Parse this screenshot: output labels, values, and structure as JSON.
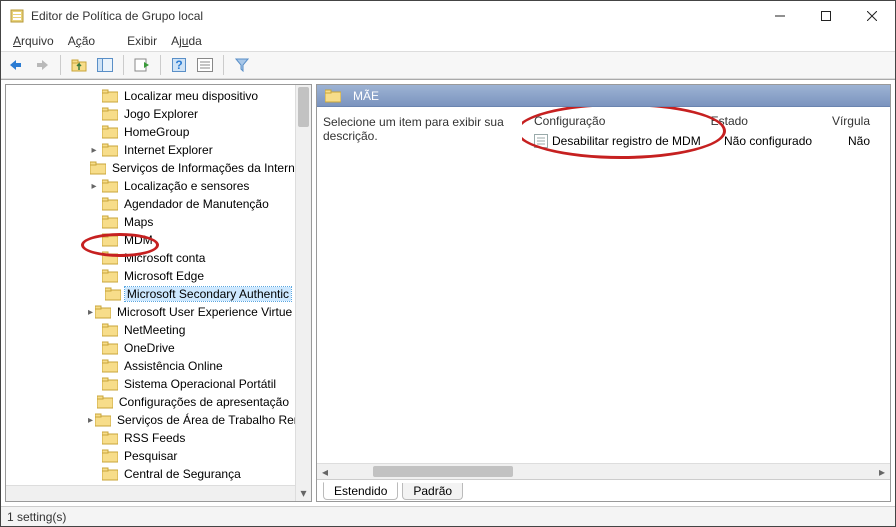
{
  "window": {
    "title": "Editor de Política de Grupo local"
  },
  "menubar": {
    "file": "Arquivo",
    "action": "Ação",
    "view": "Exibir",
    "help": "Ajuda"
  },
  "tree": {
    "items": [
      {
        "label": "Localizar meu dispositivo",
        "indent": 82,
        "exp": ""
      },
      {
        "label": "Jogo Explorer",
        "indent": 82,
        "exp": ""
      },
      {
        "label": "HomeGroup",
        "indent": 82,
        "exp": ""
      },
      {
        "label": "Internet Explorer",
        "indent": 82,
        "exp": ">"
      },
      {
        "label": "Serviços de Informações da Internet",
        "indent": 82,
        "exp": ""
      },
      {
        "label": "Localização e sensores",
        "indent": 82,
        "exp": ">"
      },
      {
        "label": "Agendador de Manutenção",
        "indent": 82,
        "exp": ""
      },
      {
        "label": "Maps",
        "indent": 82,
        "exp": ""
      },
      {
        "label": "MDM",
        "indent": 82,
        "exp": "",
        "highlighted": true
      },
      {
        "label": "Microsoft conta",
        "indent": 82,
        "exp": ""
      },
      {
        "label": "Microsoft Edge",
        "indent": 82,
        "exp": ""
      },
      {
        "label": "Microsoft Secondary Authentic",
        "indent": 96,
        "exp": "",
        "selected": true
      },
      {
        "label": "Microsoft User Experience Virtue",
        "indent": 82,
        "exp": ">"
      },
      {
        "label": "NetMeeting",
        "indent": 82,
        "exp": ""
      },
      {
        "label": "OneDrive",
        "indent": 82,
        "exp": ""
      },
      {
        "label": "Assistência Online",
        "indent": 82,
        "exp": ""
      },
      {
        "label": "Sistema Operacional Portátil",
        "indent": 82,
        "exp": ""
      },
      {
        "label": "Configurações de apresentação",
        "indent": 82,
        "exp": ""
      },
      {
        "label": "Serviços de Área de Trabalho Remota",
        "indent": 82,
        "exp": ">"
      },
      {
        "label": "RSS Feeds",
        "indent": 82,
        "exp": ""
      },
      {
        "label": "Pesquisar",
        "indent": 82,
        "exp": ""
      },
      {
        "label": "Central de Segurança",
        "indent": 82,
        "exp": ""
      }
    ]
  },
  "detail": {
    "header": "MÃE",
    "description_hint": "Selecione um item para exibir sua descrição.",
    "columns": {
      "setting": "Configuração",
      "state": "Estado",
      "comment": "Vírgula"
    },
    "rows": [
      {
        "name": "Desabilitar registro de MDM",
        "state": "Não configurado",
        "comment": "Não"
      }
    ],
    "tabs": {
      "extended": "Estendido",
      "standard": "Padrão"
    }
  },
  "status": "1 setting(s)"
}
